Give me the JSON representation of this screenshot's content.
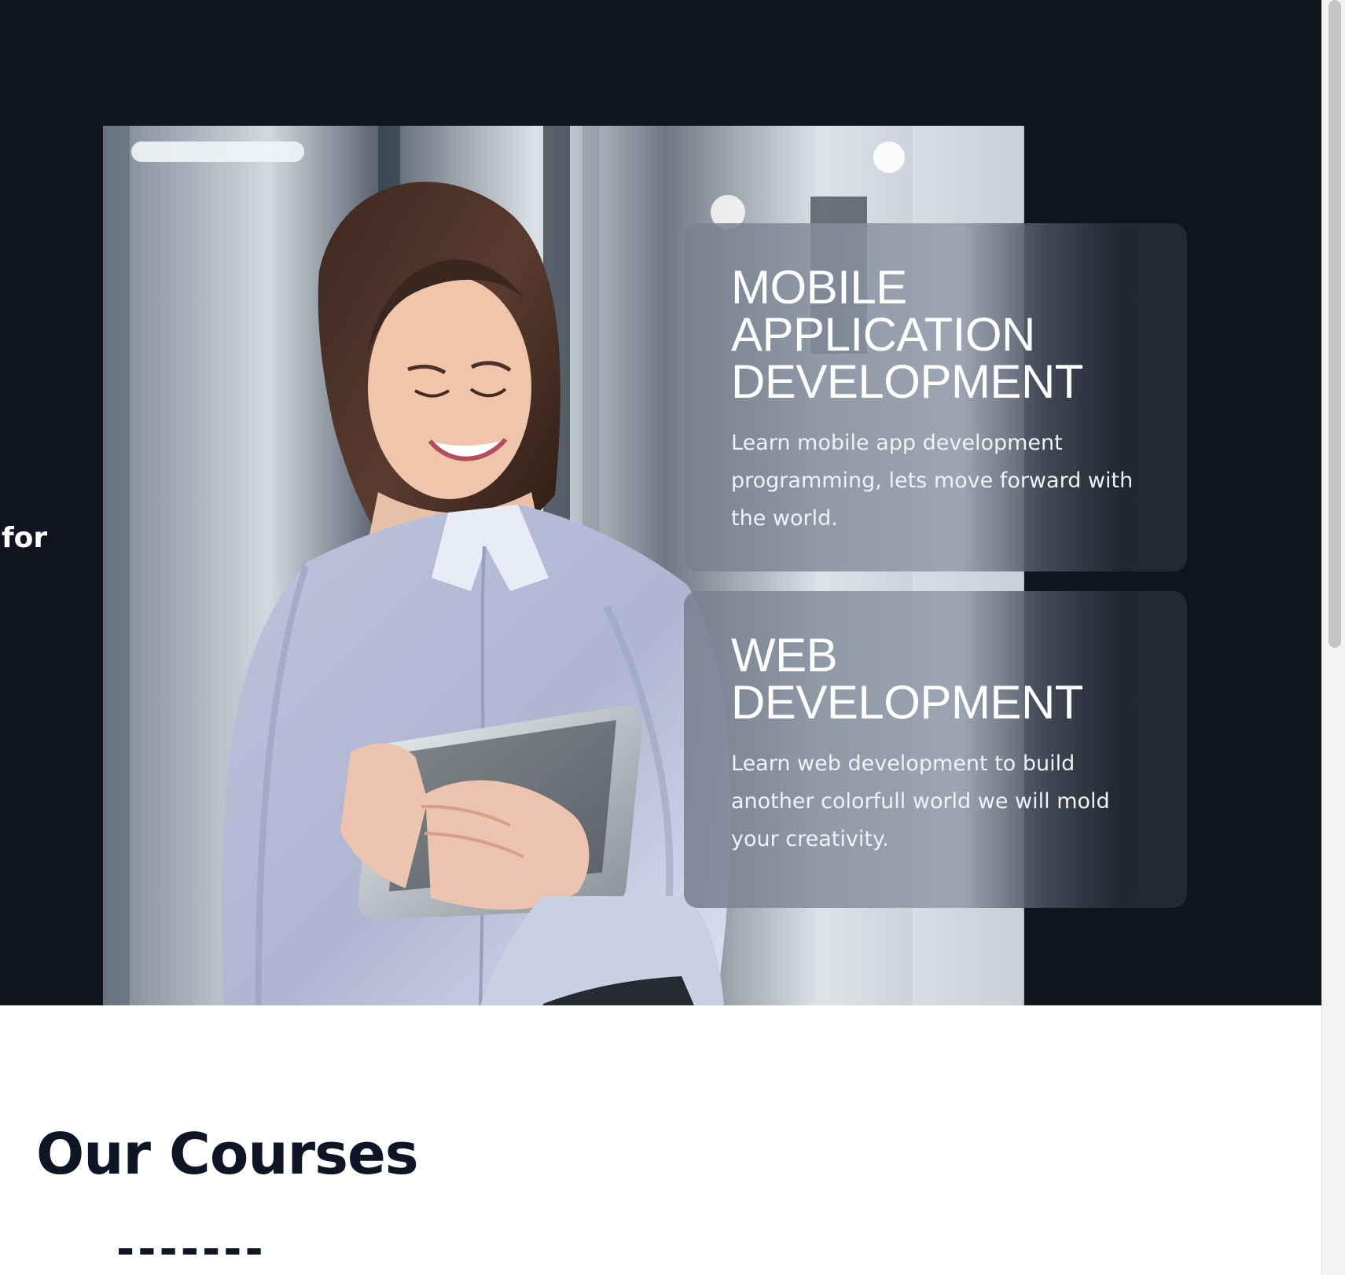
{
  "hero": {
    "side_text": "for",
    "photo_alt": "",
    "cards": [
      {
        "title": "MOBILE APPLICATION DEVELOPMENT",
        "description": "Learn mobile app development programming, lets move forward with the world."
      },
      {
        "title": "WEB DEVELOPMENT",
        "description": "Learn web development to build another colorfull world we will mold your creativity."
      }
    ]
  },
  "courses": {
    "title": "Our Courses",
    "divider": "-------"
  },
  "colors": {
    "hero_background": "#11141f",
    "card_overlay": "#242833",
    "heading_text": "#0e1524",
    "white": "#ffffff"
  },
  "icons": {
    "photo": "woman-with-tablet-photo"
  }
}
